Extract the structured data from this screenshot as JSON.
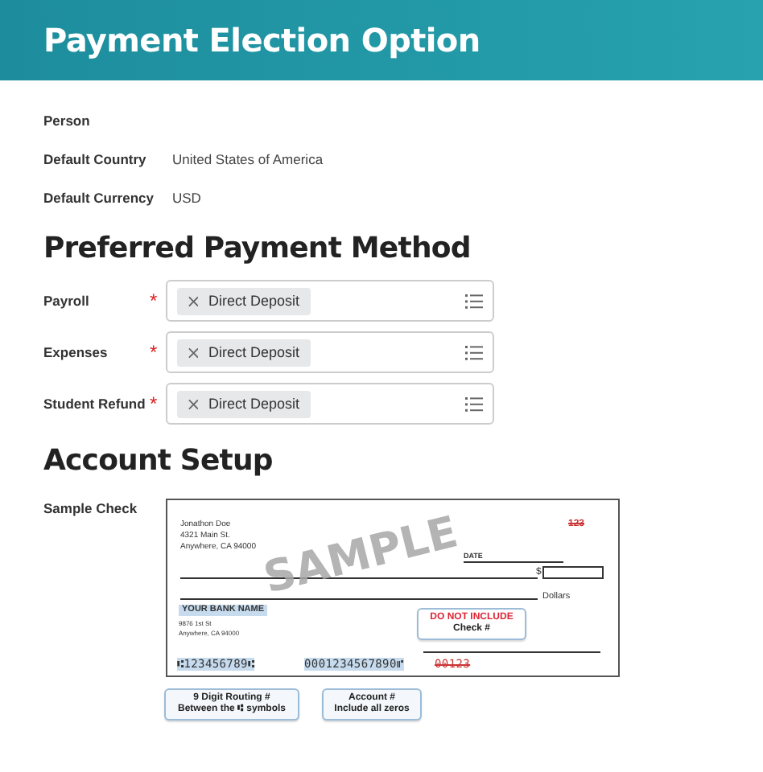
{
  "header": {
    "title": "Payment Election Option"
  },
  "details": [
    {
      "label": "Person"
    },
    {
      "label": "Default Country",
      "value": "United States of America"
    },
    {
      "label": "Default Currency",
      "value": "USD"
    }
  ],
  "payment_section": {
    "heading": "Preferred Payment Method",
    "fields": [
      {
        "label": "Payroll",
        "required_mark": "*",
        "chips": [
          "Direct Deposit"
        ]
      },
      {
        "label": "Expenses",
        "required_mark": "*",
        "chips": [
          "Direct Deposit"
        ]
      },
      {
        "label": "Student Refund",
        "required_mark": "*",
        "chips": [
          "Direct Deposit"
        ]
      }
    ]
  },
  "account_section": {
    "heading": "Account Setup",
    "sample_label": "Sample Check",
    "check": {
      "holder_lines": [
        "Jonathon Doe",
        "4321 Main St.",
        "Anywhere, CA 94000"
      ],
      "number": "123",
      "date_label": "DATE",
      "amount_symbol": "$",
      "dollars_label": "Dollars",
      "bank_name": "YOUR BANK NAME",
      "bank_lines": [
        "9876 1st St",
        "Anywhere, CA 94000"
      ],
      "watermark": "SAMPLE",
      "routing": "⑆123456789⑆",
      "account": "0001234567890⑈",
      "check_number": "00123",
      "callouts": [
        {
          "title": "DO NOT INCLUDE",
          "text": "Check #",
          "alert": true
        },
        {
          "title": "9 Digit  Routing #",
          "text": "Between the ⑆ symbols",
          "alert": false
        },
        {
          "title": "Account #",
          "text": "Include all zeros",
          "alert": false
        }
      ]
    }
  }
}
